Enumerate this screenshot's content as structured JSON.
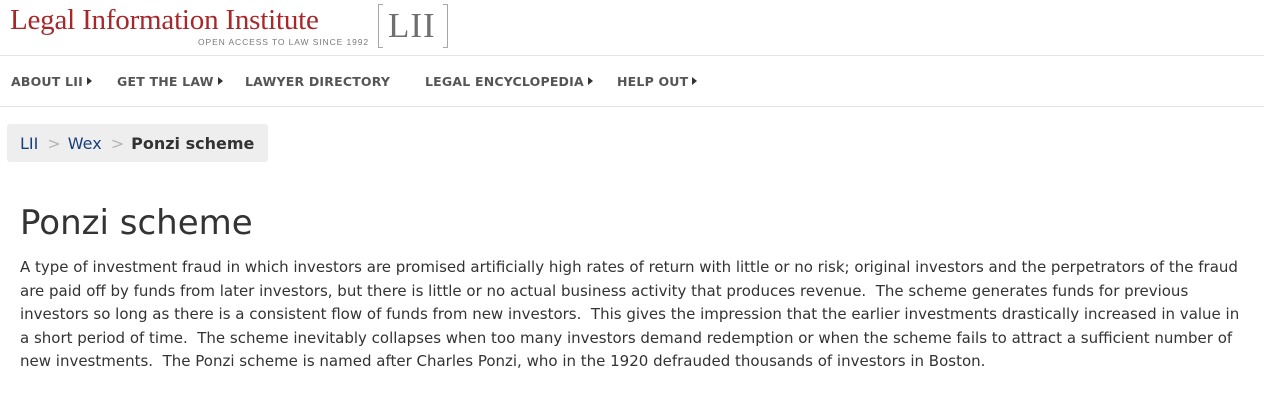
{
  "header": {
    "site_title": "Legal Information Institute",
    "tagline": "OPEN ACCESS TO LAW SINCE 1992",
    "logo_mark": "LII"
  },
  "nav": {
    "items": [
      {
        "label": "ABOUT LII",
        "has_submenu": true
      },
      {
        "label": "GET THE LAW",
        "has_submenu": true
      },
      {
        "label": "LAWYER DIRECTORY",
        "has_submenu": false
      },
      {
        "label": "LEGAL ENCYCLOPEDIA",
        "has_submenu": true
      },
      {
        "label": "HELP OUT",
        "has_submenu": true
      }
    ]
  },
  "breadcrumb": {
    "items": [
      "LII",
      "Wex"
    ],
    "separator": ">",
    "current": "Ponzi scheme"
  },
  "article": {
    "title": "Ponzi scheme",
    "definition": "A type of investment fraud in which investors are promised artificially high rates of return with little or no risk; original investors and the perpetrators of the fraud are paid off by funds from later investors, but there is little or no actual business activity that produces revenue.  The scheme generates funds for previous investors so long as there is a consistent flow of funds from new investors.  This gives the impression that the earlier investments drastically increased in value in a short period of time.  The scheme inevitably collapses when too many investors demand redemption or when the scheme fails to attract a sufficient number of new investments.  The Ponzi scheme is named after Charles Ponzi, who in the 1920 defrauded thousands of investors in Boston."
  },
  "colors": {
    "brand_red": "#a7272a",
    "link_blue": "#1a3f7a",
    "breadcrumb_bg": "#eeeeee"
  }
}
